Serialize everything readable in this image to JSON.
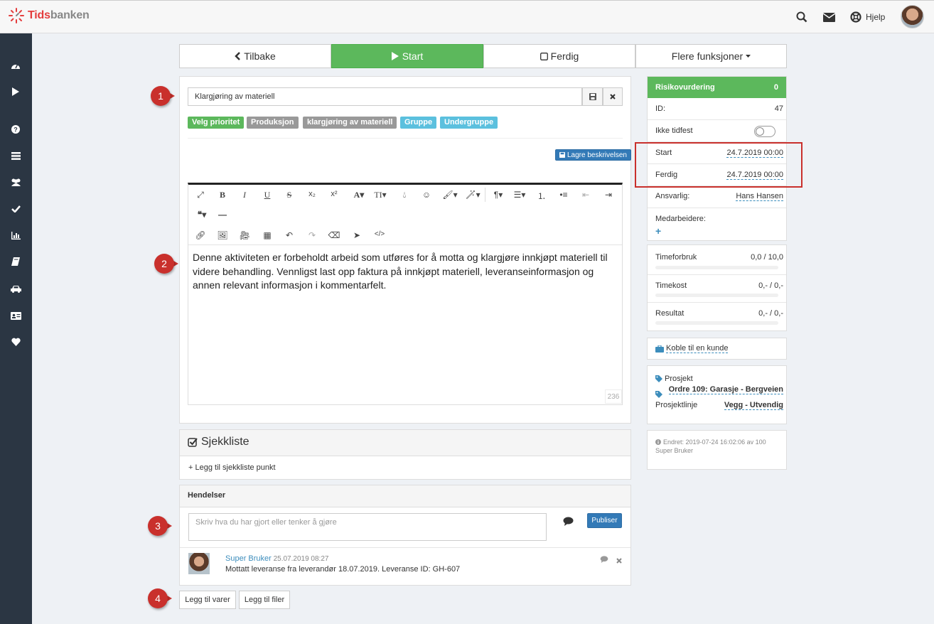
{
  "app": {
    "name_red": "Tids",
    "name_grey": "banken"
  },
  "topbar": {
    "help_label": "Hjelp"
  },
  "actionbar": {
    "back": "Tilbake",
    "start": "Start",
    "done": "Ferdig",
    "more": "Flere funksjoner"
  },
  "task": {
    "title_value": "Klargjøring av materiell",
    "tags": [
      {
        "label": "Velg prioritet",
        "color": "#5cb85c"
      },
      {
        "label": "Produksjon",
        "color": "#999999"
      },
      {
        "label": "klargjøring av materiell",
        "color": "#999999"
      },
      {
        "label": "Gruppe",
        "color": "#5bc0de"
      },
      {
        "label": "Undergruppe",
        "color": "#5bc0de"
      }
    ],
    "save_description": "Lagre beskrivelsen",
    "description": "Denne aktiviteten er forbeholdt arbeid som utføres for å motta og klargjøre innkjøpt materiell til videre behandling. Vennligst last opp faktura på innkjøpt materiell, leveranseinformasjon og annen relevant informasjon i kommentarfelt.",
    "char_count": "236"
  },
  "checklist": {
    "title": "Sjekkliste",
    "add": "+ Legg til sjekkliste punkt"
  },
  "events": {
    "title": "Hendelser",
    "placeholder": "Skriv hva du har gjort eller tenker å gjøre",
    "publish": "Publiser",
    "items": [
      {
        "author": "Super Bruker",
        "time": "25.07.2019 08:27",
        "text": "Mottatt leveranse fra leverandør 18.07.2019. Leveranse ID: GH-607"
      }
    ]
  },
  "bottom": {
    "add_items": "Legg til varer",
    "add_files": "Legg til filer"
  },
  "side": {
    "risk_label": "Risikovurdering",
    "risk_value": "0",
    "id_label": "ID:",
    "id_value": "47",
    "unscheduled_label": "Ikke tidfest",
    "start_label": "Start",
    "start_value": "24.7.2019 00:00",
    "end_label": "Ferdig",
    "end_value": "24.7.2019 00:00",
    "responsible_label": "Ansvarlig:",
    "responsible_value": "Hans Hansen",
    "coworkers_label": "Medarbeidere:",
    "time_label": "Timeforbruk",
    "time_value": "0,0 / 10,0",
    "time_fraction": 0,
    "cost_label": "Timekost",
    "cost_value": "0,- / 0,-",
    "cost_fraction": 0,
    "result_label": "Resultat",
    "result_value": "0,- / 0,-",
    "result_fraction": 0,
    "connect_customer": "Koble til en kunde",
    "project_label": "Prosjekt",
    "project_value": "Ordre 109: Garasje - Bergveien",
    "projectline_label": "Prosjektlinje",
    "projectline_value": "Vegg - Utvendig",
    "changed_text": "Endret: 2019-07-24 16:02:06 av 100",
    "changed_by": "Super Bruker"
  },
  "markers": [
    "1",
    "2",
    "3",
    "4"
  ]
}
